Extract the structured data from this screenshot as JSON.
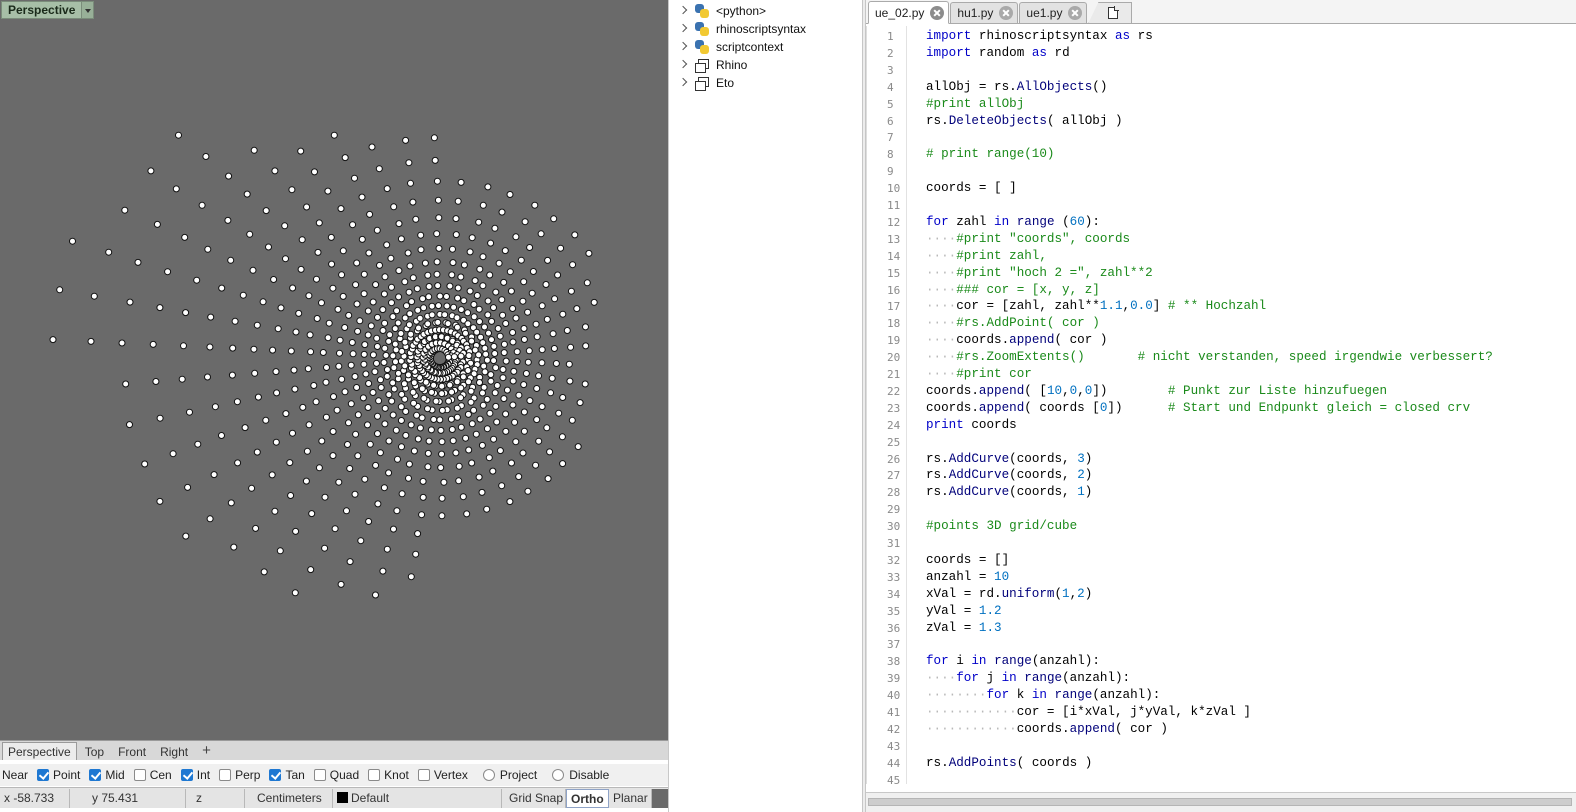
{
  "viewport": {
    "title": "Perspective",
    "tabs": [
      "Perspective",
      "Top",
      "Front",
      "Right"
    ],
    "add_tab": "+"
  },
  "osnap": [
    {
      "label": "Near",
      "type": "text"
    },
    {
      "label": "Point",
      "type": "checkbox",
      "checked": true
    },
    {
      "label": "Mid",
      "type": "checkbox",
      "checked": true
    },
    {
      "label": "Cen",
      "type": "checkbox",
      "checked": false
    },
    {
      "label": "Int",
      "type": "checkbox",
      "checked": true
    },
    {
      "label": "Perp",
      "type": "checkbox",
      "checked": false
    },
    {
      "label": "Tan",
      "type": "checkbox",
      "checked": true
    },
    {
      "label": "Quad",
      "type": "checkbox",
      "checked": false
    },
    {
      "label": "Knot",
      "type": "checkbox",
      "checked": false
    },
    {
      "label": "Vertex",
      "type": "checkbox",
      "checked": false
    },
    {
      "label": "Project",
      "type": "radio",
      "checked": false
    },
    {
      "label": "Disable",
      "type": "radio",
      "checked": false
    }
  ],
  "status": {
    "x": "x -58.733",
    "y": "y 75.431",
    "z": "z",
    "units": "Centimeters",
    "layer": "Default",
    "grid_snap": "Grid Snap",
    "ortho": "Ortho",
    "planar": "Planar"
  },
  "tree": [
    {
      "label": "<python>",
      "icon": "python-icon"
    },
    {
      "label": "rhinoscriptsyntax",
      "icon": "python-icon"
    },
    {
      "label": "scriptcontext",
      "icon": "python-icon"
    },
    {
      "label": "Rhino",
      "icon": "namespace-icon"
    },
    {
      "label": "Eto",
      "icon": "namespace-icon"
    }
  ],
  "editor": {
    "tabs": [
      "ue_02.py",
      "hu1.py",
      "ue1.py"
    ],
    "lines": [
      [
        [
          "k",
          "import"
        ],
        [
          "p",
          " rhinoscriptsyntax "
        ],
        [
          "k",
          "as"
        ],
        [
          "p",
          " rs"
        ]
      ],
      [
        [
          "k",
          "import"
        ],
        [
          "p",
          " random "
        ],
        [
          "k",
          "as"
        ],
        [
          "p",
          " rd"
        ]
      ],
      [],
      [
        [
          "p",
          "allObj = rs."
        ],
        [
          "f",
          "AllObjects"
        ],
        [
          "p",
          "()"
        ]
      ],
      [
        [
          "c",
          "#print allObj"
        ]
      ],
      [
        [
          "p",
          "rs."
        ],
        [
          "f",
          "DeleteObjects"
        ],
        [
          "p",
          "( allObj )"
        ]
      ],
      [],
      [
        [
          "c",
          "# print range(10)"
        ]
      ],
      [],
      [
        [
          "p",
          "coords = [ ]"
        ]
      ],
      [],
      [
        [
          "k",
          "for"
        ],
        [
          "p",
          " zahl "
        ],
        [
          "k",
          "in"
        ],
        [
          "p",
          " "
        ],
        [
          "f",
          "range"
        ],
        [
          "p",
          " ("
        ],
        [
          "n",
          "60"
        ],
        [
          "p",
          "):"
        ]
      ],
      [
        [
          "w",
          "····"
        ],
        [
          "c",
          "#print \"coords\", coords"
        ]
      ],
      [
        [
          "w",
          "····"
        ],
        [
          "c",
          "#print zahl,"
        ]
      ],
      [
        [
          "w",
          "····"
        ],
        [
          "c",
          "#print \"hoch 2 =\", zahl**2"
        ]
      ],
      [
        [
          "w",
          "····"
        ],
        [
          "c",
          "### cor = [x, y, z]"
        ]
      ],
      [
        [
          "w",
          "····"
        ],
        [
          "p",
          "cor = [zahl, zahl**"
        ],
        [
          "n",
          "1.1"
        ],
        [
          "p",
          ","
        ],
        [
          "n",
          "0.0"
        ],
        [
          "p",
          "] "
        ],
        [
          "c",
          "# ** Hochzahl"
        ]
      ],
      [
        [
          "w",
          "····"
        ],
        [
          "c",
          "#rs.AddPoint( cor )"
        ]
      ],
      [
        [
          "w",
          "····"
        ],
        [
          "p",
          "coords."
        ],
        [
          "f",
          "append"
        ],
        [
          "p",
          "( cor )"
        ]
      ],
      [
        [
          "w",
          "····"
        ],
        [
          "c",
          "#rs.ZoomExtents()       # nicht verstanden, speed irgendwie verbessert?"
        ]
      ],
      [
        [
          "w",
          "····"
        ],
        [
          "c",
          "#print cor"
        ]
      ],
      [
        [
          "p",
          "coords."
        ],
        [
          "f",
          "append"
        ],
        [
          "p",
          "( ["
        ],
        [
          "n",
          "10"
        ],
        [
          "p",
          ","
        ],
        [
          "n",
          "0"
        ],
        [
          "p",
          ","
        ],
        [
          "n",
          "0"
        ],
        [
          "p",
          "])        "
        ],
        [
          "c",
          "# Punkt zur Liste hinzufuegen"
        ]
      ],
      [
        [
          "p",
          "coords."
        ],
        [
          "f",
          "append"
        ],
        [
          "p",
          "( coords ["
        ],
        [
          "n",
          "0"
        ],
        [
          "p",
          "])      "
        ],
        [
          "c",
          "# Start und Endpunkt gleich = closed crv"
        ]
      ],
      [
        [
          "k",
          "print"
        ],
        [
          "p",
          " coords"
        ]
      ],
      [],
      [
        [
          "p",
          "rs."
        ],
        [
          "f",
          "AddCurve"
        ],
        [
          "p",
          "(coords, "
        ],
        [
          "n",
          "3"
        ],
        [
          "p",
          ")"
        ]
      ],
      [
        [
          "p",
          "rs."
        ],
        [
          "f",
          "AddCurve"
        ],
        [
          "p",
          "(coords, "
        ],
        [
          "n",
          "2"
        ],
        [
          "p",
          ")"
        ]
      ],
      [
        [
          "p",
          "rs."
        ],
        [
          "f",
          "AddCurve"
        ],
        [
          "p",
          "(coords, "
        ],
        [
          "n",
          "1"
        ],
        [
          "p",
          ")"
        ]
      ],
      [],
      [
        [
          "c",
          "#points 3D grid/cube"
        ]
      ],
      [],
      [
        [
          "p",
          "coords = []"
        ]
      ],
      [
        [
          "p",
          "anzahl = "
        ],
        [
          "n",
          "10"
        ]
      ],
      [
        [
          "p",
          "xVal = rd."
        ],
        [
          "f",
          "uniform"
        ],
        [
          "p",
          "("
        ],
        [
          "n",
          "1"
        ],
        [
          "p",
          ","
        ],
        [
          "n",
          "2"
        ],
        [
          "p",
          ")"
        ]
      ],
      [
        [
          "p",
          "yVal = "
        ],
        [
          "n",
          "1.2"
        ]
      ],
      [
        [
          "p",
          "zVal = "
        ],
        [
          "n",
          "1.3"
        ]
      ],
      [],
      [
        [
          "k",
          "for"
        ],
        [
          "p",
          " i "
        ],
        [
          "k",
          "in"
        ],
        [
          "p",
          " "
        ],
        [
          "f",
          "range"
        ],
        [
          "p",
          "(anzahl):"
        ]
      ],
      [
        [
          "w",
          "····"
        ],
        [
          "k",
          "for"
        ],
        [
          "p",
          " j "
        ],
        [
          "k",
          "in"
        ],
        [
          "p",
          " "
        ],
        [
          "f",
          "range"
        ],
        [
          "p",
          "(anzahl):"
        ]
      ],
      [
        [
          "w",
          "········"
        ],
        [
          "k",
          "for"
        ],
        [
          "p",
          " k "
        ],
        [
          "k",
          "in"
        ],
        [
          "p",
          " "
        ],
        [
          "f",
          "range"
        ],
        [
          "p",
          "(anzahl):"
        ]
      ],
      [
        [
          "w",
          "············"
        ],
        [
          "p",
          "cor = [i*xVal, j*yVal, k*zVal ]"
        ]
      ],
      [
        [
          "w",
          "············"
        ],
        [
          "p",
          "coords."
        ],
        [
          "f",
          "append"
        ],
        [
          "p",
          "( cor )"
        ]
      ],
      [],
      [
        [
          "p",
          "rs."
        ],
        [
          "f",
          "AddPoints"
        ],
        [
          "p",
          "( coords )"
        ]
      ],
      []
    ]
  }
}
